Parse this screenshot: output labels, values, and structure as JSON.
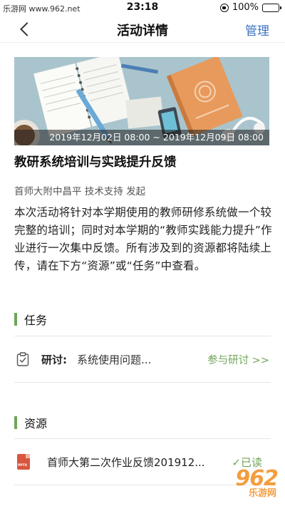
{
  "status_bar": {
    "watermark": "乐游网 www.962.net",
    "time": "23:18",
    "battery": "100%"
  },
  "nav": {
    "title": "活动详情",
    "manage_label": "管理"
  },
  "banner": {
    "date_range": "2019年12月02日 08:00 ~ 2019年12月09日 08:00"
  },
  "activity": {
    "title": "教研系统培训与实践提升反馈",
    "organizer": "首师大附中昌平 技术支持 发起",
    "description": "本次活动将针对本学期使用的教师研修系统做一个较完整的培训；同时对本学期的“教师实践能力提升”作业进行一次集中反馈。所有涉及到的资源都将陆续上传，请在下方“资源”或“任务”中查看。"
  },
  "tasks": {
    "section_title": "任务",
    "items": [
      {
        "type_label": "研讨:",
        "name": "系统使用问题...",
        "action": "参与研讨 >>"
      }
    ]
  },
  "resources": {
    "section_title": "资源",
    "items": [
      {
        "file_type": "PPTX",
        "name": "首师大第二次作业反馈201912...",
        "status": "✓已读"
      }
    ]
  },
  "watermark_bottom": {
    "brand": "962",
    "sub": "乐游网"
  },
  "colors": {
    "accent": "#6fa557",
    "link": "#3a72c4",
    "battery": "#4cd964"
  },
  "icons": [
    "back-chevron-icon",
    "lock-rotation-icon",
    "battery-icon",
    "clipboard-check-icon",
    "pptx-file-icon"
  ]
}
